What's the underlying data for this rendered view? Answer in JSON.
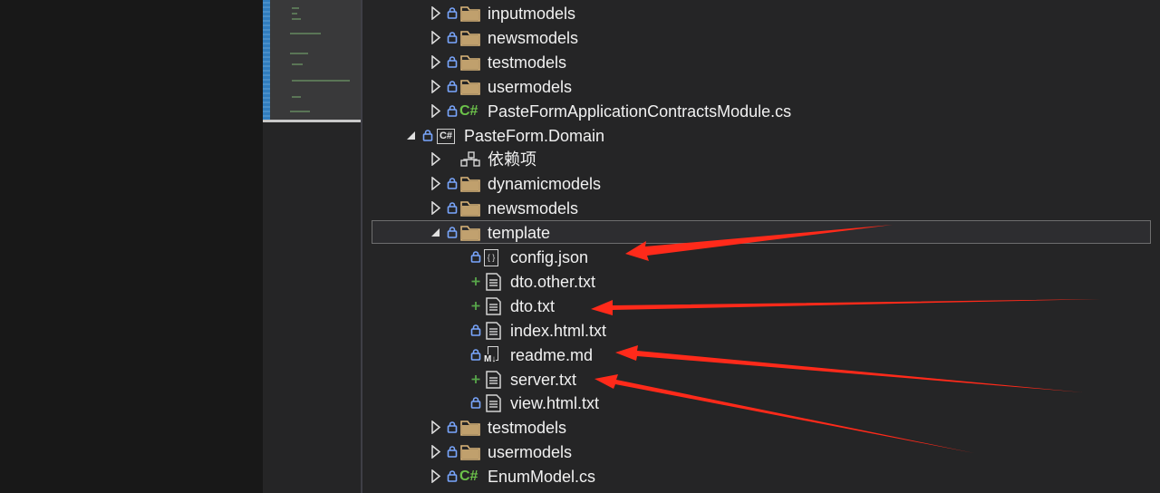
{
  "solution_explorer": {
    "items": [
      {
        "label": "inputmodels",
        "icon": "folder-icon",
        "status": "lock",
        "depth": 1,
        "expander": "collapsed"
      },
      {
        "label": "newsmodels",
        "icon": "folder-icon",
        "status": "lock",
        "depth": 1,
        "expander": "collapsed"
      },
      {
        "label": "testmodels",
        "icon": "folder-icon",
        "status": "lock",
        "depth": 1,
        "expander": "collapsed"
      },
      {
        "label": "usermodels",
        "icon": "folder-icon",
        "status": "lock",
        "depth": 1,
        "expander": "collapsed"
      },
      {
        "label": "PasteFormApplicationContractsModule.cs",
        "icon": "csharp-file-icon",
        "icon_text": "C#",
        "status": "lock",
        "depth": 1,
        "expander": "collapsed"
      },
      {
        "label": "PasteForm.Domain",
        "icon": "csharp-project-icon",
        "icon_text": "C#",
        "status": "lock",
        "depth": 0,
        "expander": "expanded"
      },
      {
        "label": "依赖项",
        "icon": "dependencies-icon",
        "status": "",
        "depth": 1,
        "expander": "collapsed"
      },
      {
        "label": "dynamicmodels",
        "icon": "folder-icon",
        "status": "lock",
        "depth": 1,
        "expander": "collapsed"
      },
      {
        "label": "newsmodels",
        "icon": "folder-icon",
        "status": "lock",
        "depth": 1,
        "expander": "collapsed"
      },
      {
        "label": "template",
        "icon": "folder-icon",
        "status": "lock",
        "depth": 1,
        "expander": "expanded",
        "selected": true
      },
      {
        "label": "config.json",
        "icon": "json-file-icon",
        "icon_text": "{ }",
        "status": "lock",
        "depth": 2,
        "expander": ""
      },
      {
        "label": "dto.other.txt",
        "icon": "text-file-icon",
        "status": "add",
        "depth": 2,
        "expander": ""
      },
      {
        "label": "dto.txt",
        "icon": "text-file-icon",
        "status": "add",
        "depth": 2,
        "expander": ""
      },
      {
        "label": "index.html.txt",
        "icon": "text-file-icon",
        "status": "lock",
        "depth": 2,
        "expander": ""
      },
      {
        "label": "readme.md",
        "icon": "markdown-file-icon",
        "icon_text": "M↓",
        "status": "lock",
        "depth": 2,
        "expander": ""
      },
      {
        "label": "server.txt",
        "icon": "text-file-icon",
        "status": "add",
        "depth": 2,
        "expander": ""
      },
      {
        "label": "view.html.txt",
        "icon": "text-file-icon",
        "status": "lock",
        "depth": 2,
        "expander": ""
      },
      {
        "label": "testmodels",
        "icon": "folder-icon",
        "status": "lock",
        "depth": 1,
        "expander": "collapsed"
      },
      {
        "label": "usermodels",
        "icon": "folder-icon",
        "status": "lock",
        "depth": 1,
        "expander": "collapsed"
      },
      {
        "label": "EnumModel.cs",
        "icon": "csharp-file-icon",
        "icon_text": "C#",
        "status": "lock",
        "depth": 1,
        "expander": "collapsed"
      }
    ]
  },
  "colors": {
    "tree_background": "#252526",
    "text": "#f1f1f1",
    "folder": "#dcb67a",
    "lock": "#7aa7ff",
    "add": "#57a64a",
    "csharp": "#6cc24a",
    "annotation_arrow": "#ff2a1a"
  }
}
